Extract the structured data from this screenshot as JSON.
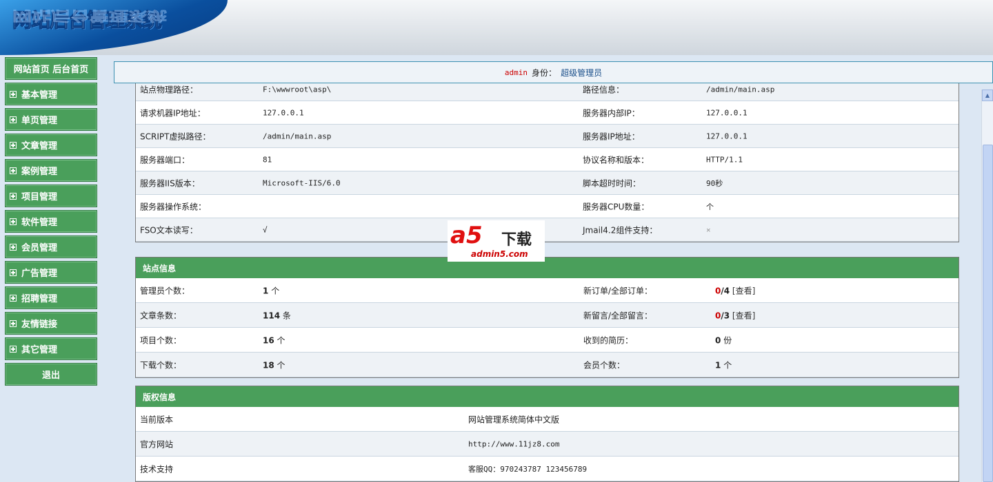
{
  "header": {
    "logo_text": "网站后台管理系统"
  },
  "sidebar": {
    "home": "网站首页 后台首页",
    "items": [
      "基本管理",
      "单页管理",
      "文章管理",
      "案例管理",
      "项目管理",
      "软件管理",
      "会员管理",
      "广告管理",
      "招聘管理",
      "友情链接",
      "其它管理"
    ],
    "logout": "退出"
  },
  "topbar": {
    "user": "admin",
    "role_label": "身份：",
    "role": "超级管理员"
  },
  "server": {
    "rows": [
      [
        "站点物理路径：",
        "F:\\wwwroot\\asp\\",
        "路径信息：",
        "/admin/main.asp"
      ],
      [
        "请求机器IP地址：",
        "127.0.0.1",
        "服务器内部IP：",
        "127.0.0.1"
      ],
      [
        "SCRIPT虚拟路径：",
        "/admin/main.asp",
        "服务器IP地址：",
        "127.0.0.1"
      ],
      [
        "服务器端口：",
        "81",
        "协议名称和版本：",
        "HTTP/1.1"
      ],
      [
        "服务器IIS版本：",
        "Microsoft-IIS/6.0",
        "脚本超时时间：",
        "90秒"
      ],
      [
        "服务器操作系统：",
        "",
        "服务器CPU数量：",
        "个"
      ],
      [
        "FSO文本读写：",
        "√",
        "Jmail4.2组件支持：",
        "×"
      ]
    ]
  },
  "site": {
    "title": "站点信息",
    "rows": [
      {
        "l1": "管理员个数：",
        "v1": "1",
        "u1": "个",
        "l2": "新订单/全部订单：",
        "new": "0",
        "total": "/4",
        "link": "[查看]"
      },
      {
        "l1": "文章条数：",
        "v1": "114",
        "u1": "条",
        "l2": "新留言/全部留言：",
        "new": "0",
        "total": "/3",
        "link": "[查看]"
      },
      {
        "l1": "项目个数：",
        "v1": "16",
        "u1": "个",
        "l2": "收到的简历：",
        "v2": "0",
        "u2": "份"
      },
      {
        "l1": "下载个数：",
        "v1": "18",
        "u1": "个",
        "l2": "会员个数：",
        "v2": "1",
        "u2": "个"
      }
    ]
  },
  "copyright": {
    "title": "版权信息",
    "rows": [
      [
        "当前版本",
        "网站管理系统简体中文版"
      ],
      [
        "官方网站",
        "http://www.11jz8.com"
      ],
      [
        "技术支持",
        "客服QQ：970243787 123456789"
      ]
    ]
  },
  "watermark": {
    "brand": "a5",
    "brand_cn": "下载",
    "url": "admin5.com"
  }
}
